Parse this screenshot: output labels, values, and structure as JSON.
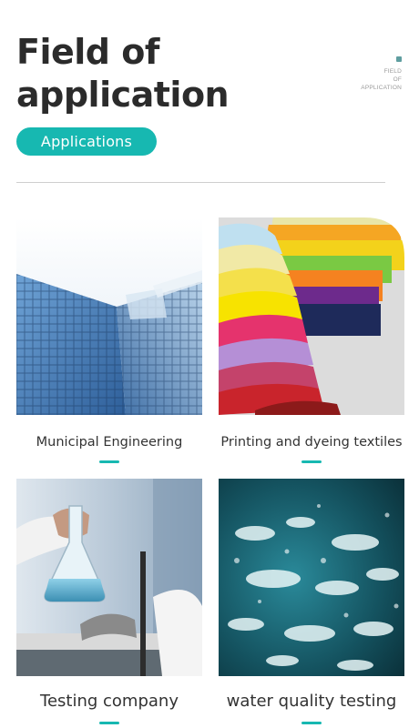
{
  "header": {
    "title_line1": "Field of",
    "title_line2": "application",
    "corner_line1": "FIELD",
    "corner_line2": "OF",
    "corner_line3": "APPLICATION",
    "pill_label": "Applications"
  },
  "cards": [
    {
      "label": "Municipal Engineering",
      "image": "glass-skyscraper-image"
    },
    {
      "label": "Printing and dyeing textiles",
      "image": "colored-fabric-stack-image"
    },
    {
      "label": "Testing company",
      "image": "laboratory-flask-image"
    },
    {
      "label": "water quality testing",
      "image": "ocean-water-image"
    }
  ],
  "colors": {
    "accent": "#17b8b1",
    "title": "#2b2b2b",
    "divider": "#cfcfcf"
  }
}
